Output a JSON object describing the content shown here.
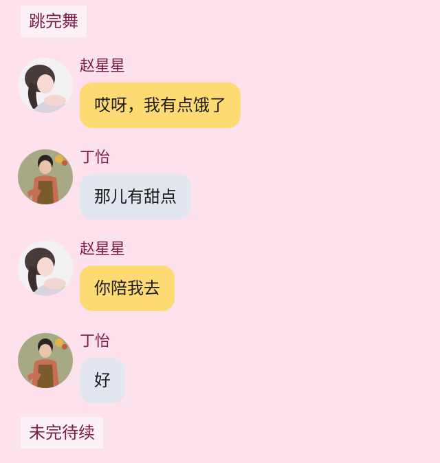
{
  "header_tag": "跳完舞",
  "footer_tag": "未完待续",
  "colors": {
    "background": "#fde1ec",
    "tag_background": "#fcf1f6",
    "name_text": "#7a1b4a",
    "bubble_female": "#fddb72",
    "bubble_male": "#e2e6ee"
  },
  "messages": [
    {
      "sender": "赵星星",
      "text": "哎呀，我有点饿了",
      "avatar": "female-avatar"
    },
    {
      "sender": "丁怡",
      "text": "那儿有甜点",
      "avatar": "male-avatar"
    },
    {
      "sender": "赵星星",
      "text": "你陪我去",
      "avatar": "female-avatar"
    },
    {
      "sender": "丁怡",
      "text": "好",
      "avatar": "male-avatar"
    }
  ]
}
